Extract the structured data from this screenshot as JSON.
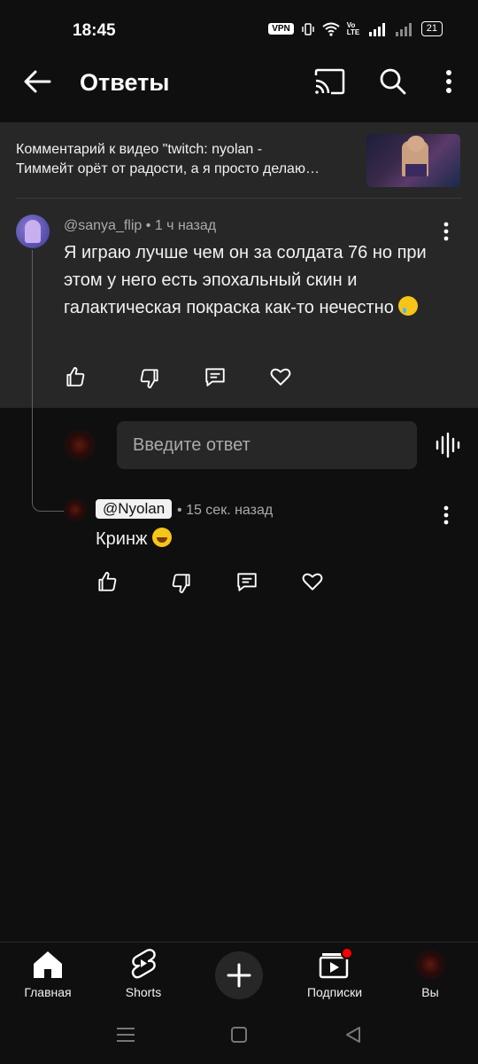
{
  "status_bar": {
    "time": "18:45",
    "vpn": "VPN",
    "volte": "Vo LTE",
    "battery": "21"
  },
  "header": {
    "title": "Ответы",
    "back_icon": "arrow-left-icon",
    "cast_icon": "cast-icon",
    "search_icon": "search-icon",
    "more_icon": "more-vert-icon"
  },
  "context": {
    "line1": "Комментарий к видео \"twitch: nyolan -",
    "line2": "Тиммейт орёт от радости, а я просто делаю…"
  },
  "parent_comment": {
    "author": "@sanya_flip",
    "time": "1 ч назад",
    "separator": "•",
    "text": "Я играю лучше чем он за солдата 76 но при этом у него есть эпохальный скин и галактическая покраска как-то нечестно"
  },
  "reply_box": {
    "placeholder": "Введите ответ"
  },
  "reply": {
    "mention": "@Nyolan",
    "time": "15 сек. назад",
    "separator": "•",
    "text": "Кринж"
  },
  "bottom_nav": {
    "home": "Главная",
    "shorts": "Shorts",
    "subscriptions": "Подписки",
    "you": "Вы"
  },
  "colors": {
    "background": "#0f0f0f",
    "context_bg": "#272727",
    "notification_dot": "#ff0000"
  }
}
